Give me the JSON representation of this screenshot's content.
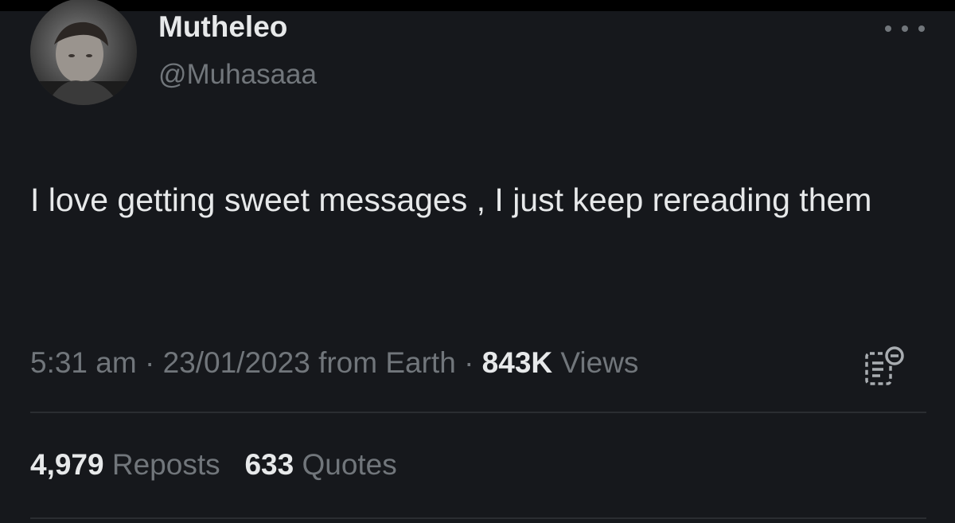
{
  "author": {
    "display_name": "Mutheleo",
    "handle": "@Muhasaaa",
    "avatar_icon": "profile-photo"
  },
  "tweet": {
    "text": "I love getting sweet messages , I just keep rereading them"
  },
  "meta": {
    "time": "5:31 am",
    "separator": "·",
    "date": "23/01/2023",
    "source": "from Earth",
    "views_count": "843K",
    "views_label": "Views"
  },
  "stats": {
    "reposts_count": "4,979",
    "reposts_label": "Reposts",
    "quotes_count": "633",
    "quotes_label": "Quotes"
  },
  "icons": {
    "more": "more-horizontal-icon",
    "analytics": "post-analytics-icon"
  },
  "colors": {
    "background": "#16181c",
    "primary_text": "#e7e9ea",
    "secondary_text": "#71767b"
  }
}
